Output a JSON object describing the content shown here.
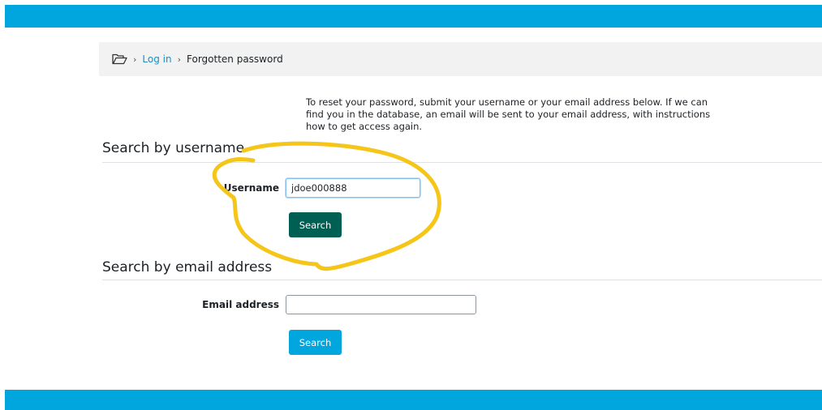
{
  "breadcrumb": {
    "home_icon": "folder-open-icon",
    "items": [
      {
        "label": "Log in"
      },
      {
        "label": "Forgotten password"
      }
    ]
  },
  "intro_text": "To reset your password, submit your username or your email address below. If we can find you in the database, an email will be sent to your email address, with instructions how to get access again.",
  "username_section": {
    "title": "Search by username",
    "field_label": "Username",
    "field_value": "jdoe000888",
    "button_label": "Search"
  },
  "email_section": {
    "title": "Search by email address",
    "field_label": "Email address",
    "field_value": "",
    "button_label": "Search"
  },
  "colors": {
    "header_bar": "#00a6dd",
    "primary_button": "#005f53",
    "secondary_button": "#00a6dd",
    "link": "#1a8fc6",
    "annotation_circle": "#f5c518"
  }
}
